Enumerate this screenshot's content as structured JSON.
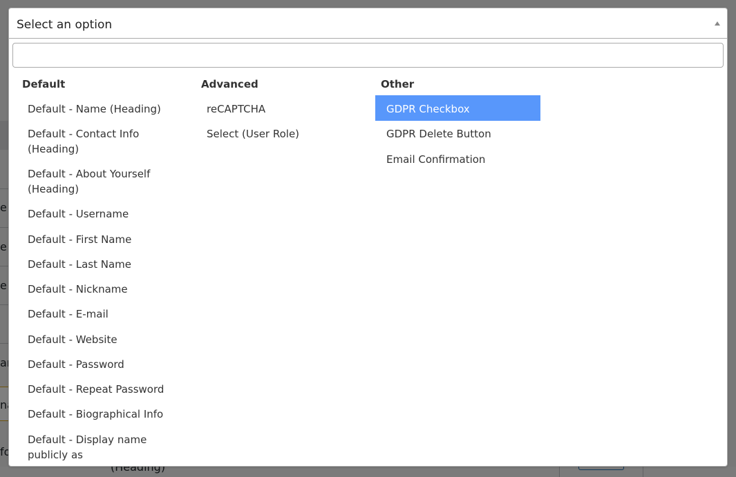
{
  "dropdown": {
    "selected_text": "Select an option",
    "search_value": "",
    "search_placeholder": ""
  },
  "groups": [
    {
      "heading": "Default",
      "options": [
        "Default - Name (Heading)",
        "Default - Contact Info (Heading)",
        "Default - About Yourself (Heading)",
        "Default - Username",
        "Default - First Name",
        "Default - Last Name",
        "Default - Nickname",
        "Default - E-mail",
        "Default - Website",
        "Default - Password",
        "Default - Repeat Password",
        "Default - Biographical Info",
        "Default - Display name publicly as"
      ]
    },
    {
      "heading": "Advanced",
      "options": [
        "reCAPTCHA",
        "Select (User Role)"
      ]
    },
    {
      "heading": "Other",
      "options": [
        "GDPR Checkbox",
        "GDPR Delete Button",
        "Email Confirmation"
      ]
    }
  ],
  "highlighted_option": "GDPR Checkbox",
  "background": {
    "peek_text_1": "e",
    "peek_text_2": "e",
    "peek_text_3": "e",
    "peek_text_4": "am",
    "peek_text_5": "na",
    "peek_text_6": "fo",
    "bottom_text": "(Heading)"
  },
  "colors": {
    "highlight": "#5897fb",
    "overlay": "rgba(0,0,0,0.5)"
  }
}
